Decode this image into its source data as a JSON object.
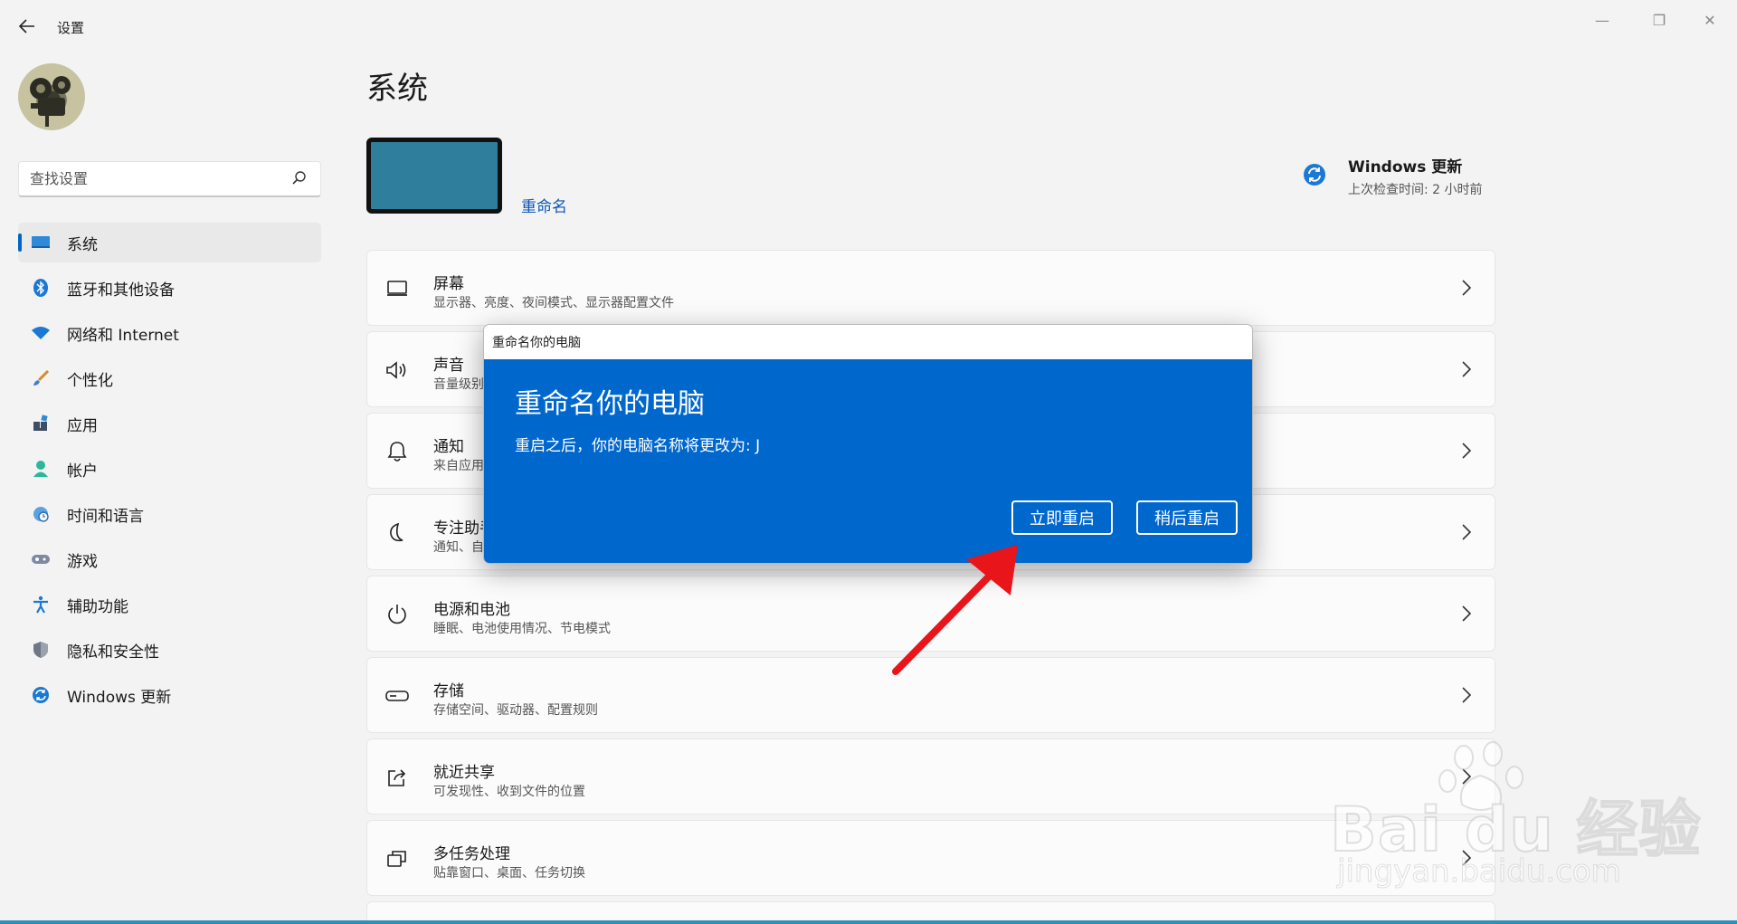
{
  "window": {
    "title": "设置",
    "back_icon": "arrow-left-icon",
    "min_symbol": "—",
    "max_symbol": "❐",
    "close_symbol": "✕"
  },
  "search": {
    "placeholder": "查找设置"
  },
  "sidebar": {
    "items": [
      {
        "label": "系统",
        "icon": "system-display-icon",
        "active": true
      },
      {
        "label": "蓝牙和其他设备",
        "icon": "bluetooth-icon"
      },
      {
        "label": "网络和 Internet",
        "icon": "wifi-icon"
      },
      {
        "label": "个性化",
        "icon": "brush-icon"
      },
      {
        "label": "应用",
        "icon": "apps-icon"
      },
      {
        "label": "帐户",
        "icon": "account-icon"
      },
      {
        "label": "时间和语言",
        "icon": "globe-clock-icon"
      },
      {
        "label": "游戏",
        "icon": "gamepad-icon"
      },
      {
        "label": "辅助功能",
        "icon": "accessibility-icon"
      },
      {
        "label": "隐私和安全性",
        "icon": "shield-icon"
      },
      {
        "label": "Windows 更新",
        "icon": "sync-icon"
      }
    ]
  },
  "main": {
    "title": "系统",
    "rename_link": "重命名",
    "update": {
      "title": "Windows 更新",
      "subtitle": "上次检查时间: 2 小时前"
    },
    "cards": [
      {
        "title": "屏幕",
        "subtitle": "显示器、亮度、夜间模式、显示器配置文件",
        "icon": "monitor-icon"
      },
      {
        "title": "声音",
        "subtitle": "音量级别",
        "icon": "speaker-icon"
      },
      {
        "title": "通知",
        "subtitle": "来自应用",
        "icon": "bell-icon"
      },
      {
        "title": "专注助手",
        "subtitle": "通知、自",
        "icon": "moon-icon"
      },
      {
        "title": "电源和电池",
        "subtitle": "睡眠、电池使用情况、节电模式",
        "icon": "power-icon"
      },
      {
        "title": "存储",
        "subtitle": "存储空间、驱动器、配置规则",
        "icon": "storage-drive-icon"
      },
      {
        "title": "就近共享",
        "subtitle": "可发现性、收到文件的位置",
        "icon": "share-icon"
      },
      {
        "title": "多任务处理",
        "subtitle": "贴靠窗口、桌面、任务切换",
        "icon": "multitask-icon"
      }
    ]
  },
  "dialog": {
    "window_title": "重命名你的电脑",
    "heading": "重命名你的电脑",
    "message": "重启之后，你的电脑名称将更改为: J",
    "restart_now": "立即重启",
    "restart_later": "稍后重启"
  },
  "watermark": {
    "main": "Bai du 经验",
    "sub": "jingyan.baidu.com"
  },
  "colors": {
    "accent": "#0067c0",
    "dialog_blue": "#0067cd",
    "arrow": "#e8161a"
  }
}
